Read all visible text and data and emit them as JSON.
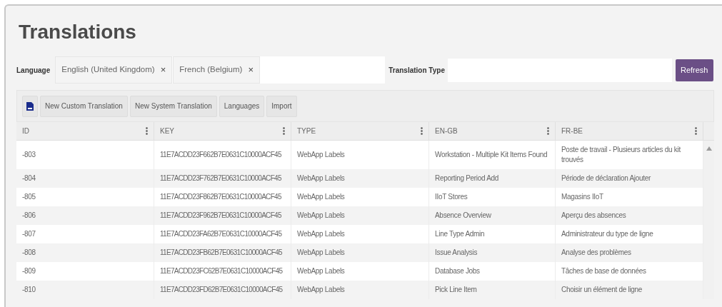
{
  "title": "Translations",
  "filters": {
    "language_label": "Language",
    "languages": [
      {
        "label": "English (United Kingdom)",
        "remove": "×"
      },
      {
        "label": "French (Belgium)",
        "remove": "×"
      }
    ],
    "translation_type_label": "Translation Type",
    "refresh": "Refresh"
  },
  "toolbar": [
    "New Custom Translation",
    "New System Translation",
    "Languages",
    "Import"
  ],
  "table": {
    "columns": [
      "ID",
      "KEY",
      "TYPE",
      "EN-GB",
      "FR-BE"
    ],
    "rows": [
      [
        "-803",
        "11E7ACDD23F662B7E0631C10000ACF45",
        "WebApp Labels",
        "Workstation - Multiple Kit Items Found",
        "Poste de travail - Plusieurs articles du kit trouvés"
      ],
      [
        "-804",
        "11E7ACDD23F762B7E0631C10000ACF45",
        "WebApp Labels",
        "Reporting Period Add",
        "Période de déclaration Ajouter"
      ],
      [
        "-805",
        "11E7ACDD23F862B7E0631C10000ACF45",
        "WebApp Labels",
        "IIoT Stores",
        "Magasins IIoT"
      ],
      [
        "-806",
        "11E7ACDD23F962B7E0631C10000ACF45",
        "WebApp Labels",
        "Absence Overview",
        "Aperçu des absences"
      ],
      [
        "-807",
        "11E7ACDD23FA62B7E0631C10000ACF45",
        "WebApp Labels",
        "Line Type Admin",
        "Administrateur du type de ligne"
      ],
      [
        "-808",
        "11E7ACDD23FB62B7E0631C10000ACF45",
        "WebApp Labels",
        "Issue Analysis",
        "Analyse des problèmes"
      ],
      [
        "-809",
        "11E7ACDD23FC62B7E0631C10000ACF45",
        "WebApp Labels",
        "Database Jobs",
        "Tâches de base de données"
      ],
      [
        "-810",
        "11E7ACDD23FD62B7E0631C10000ACF45",
        "WebApp Labels",
        "Pick Line Item",
        "Choisir un élément de ligne"
      ]
    ]
  }
}
